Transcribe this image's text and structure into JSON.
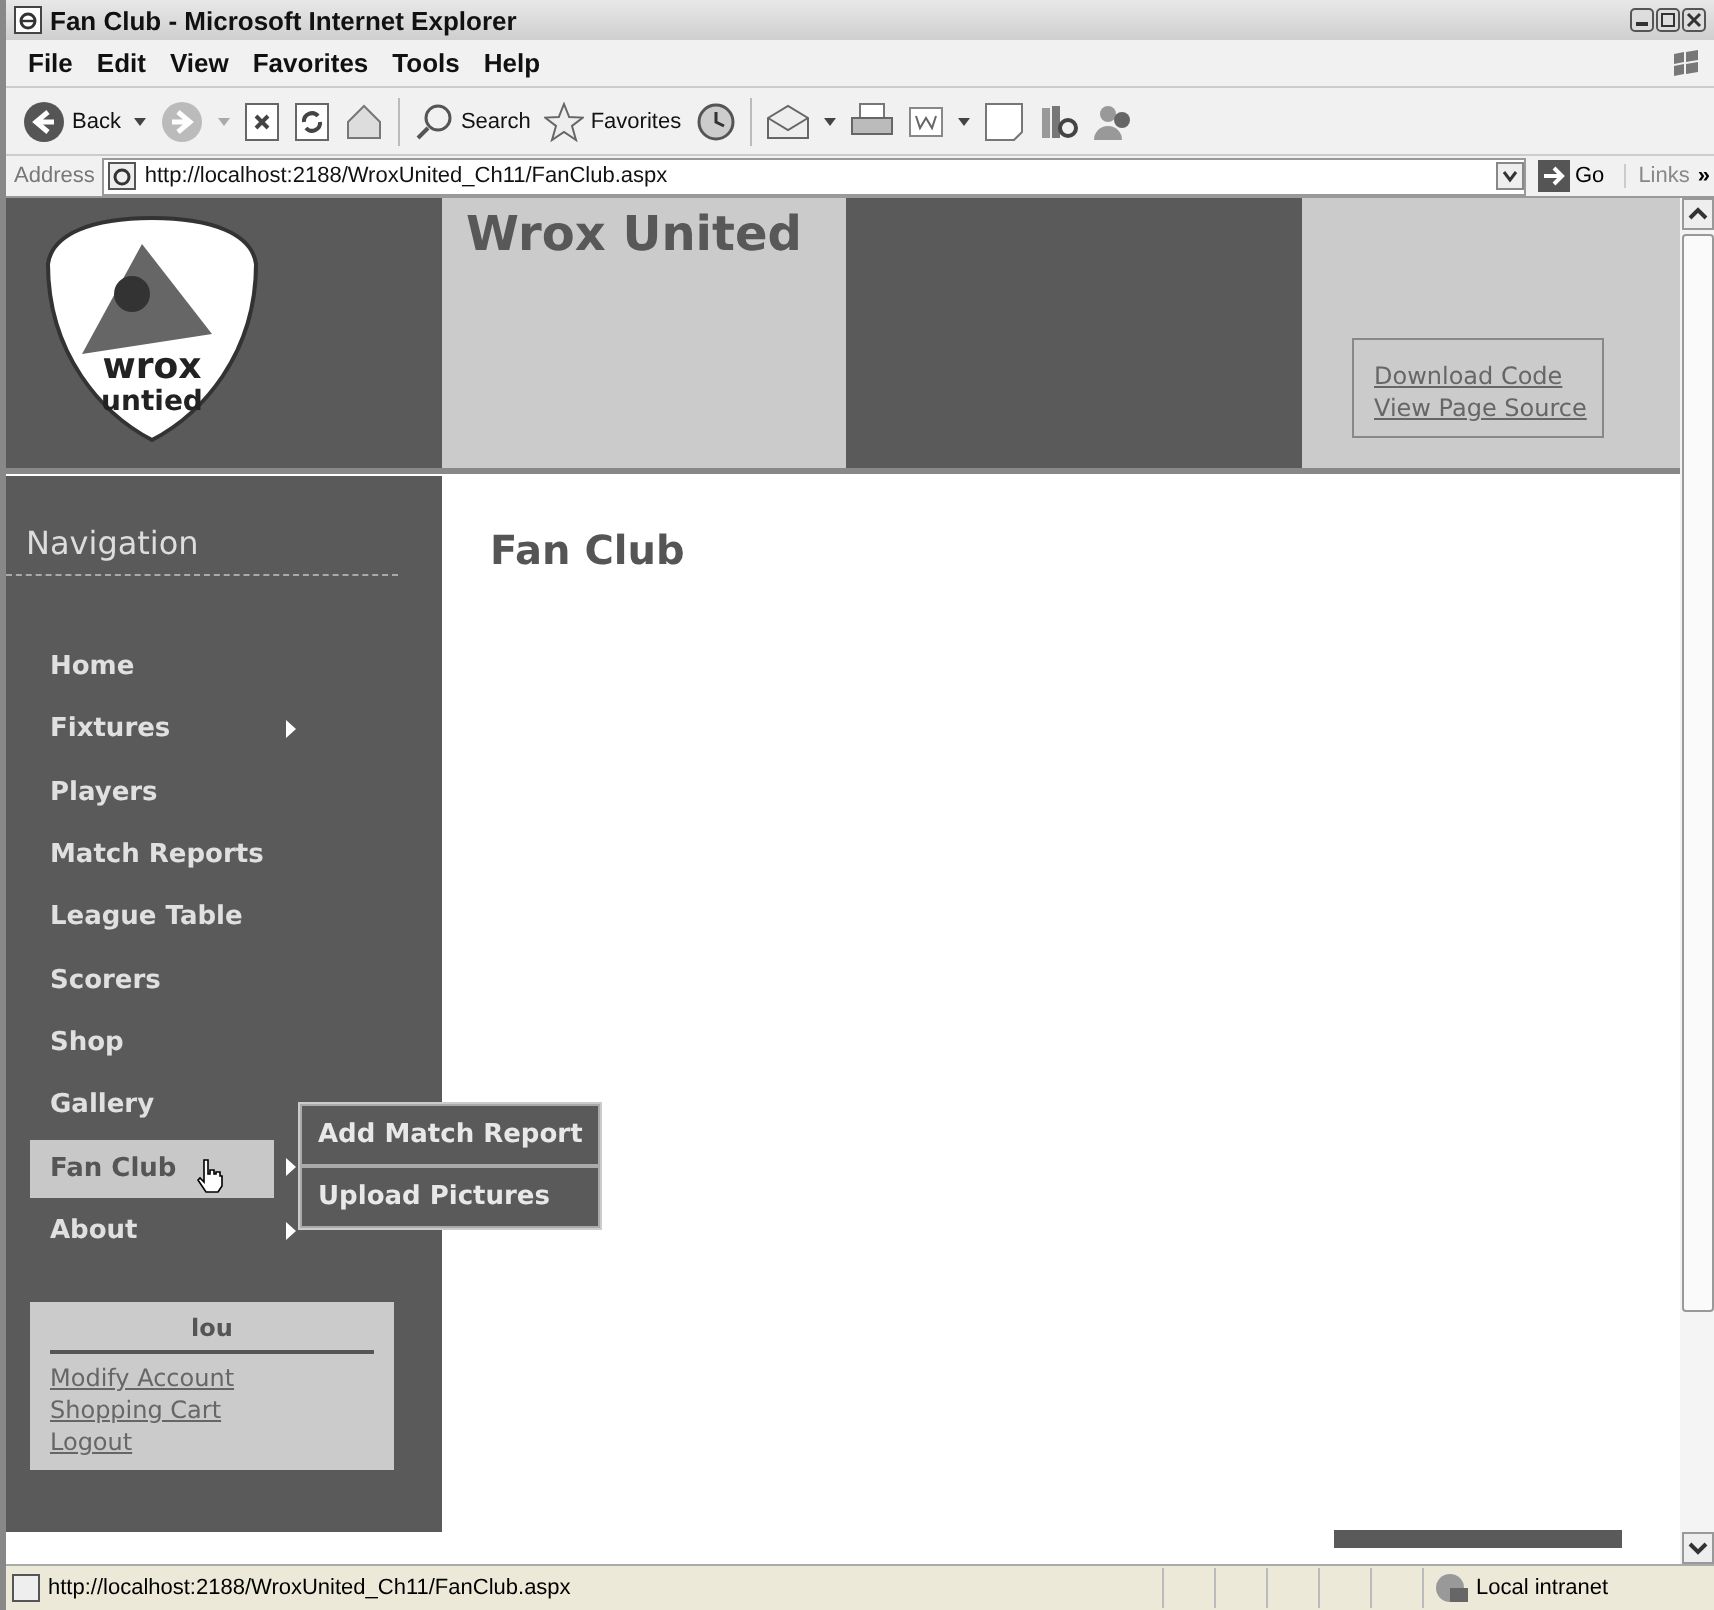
{
  "window": {
    "title": "Fan Club - Microsoft Internet Explorer"
  },
  "menu_bar": [
    "File",
    "Edit",
    "View",
    "Favorites",
    "Tools",
    "Help"
  ],
  "toolbar": {
    "back": "Back",
    "search": "Search",
    "favorites": "Favorites"
  },
  "address_bar": {
    "label": "Address",
    "url": "http://localhost:2188/WroxUnited_Ch11/FanClub.aspx",
    "go": "Go",
    "links": "Links",
    "more": "»"
  },
  "site": {
    "title": "Wrox United",
    "logo_text": [
      "wrox",
      "untied"
    ],
    "header_links": [
      "Download Code",
      "View Page Source"
    ]
  },
  "navigation": {
    "heading": "Navigation",
    "items": [
      {
        "label": "Home",
        "submenu": false,
        "selected": false
      },
      {
        "label": "Fixtures",
        "submenu": true,
        "selected": false
      },
      {
        "label": "Players",
        "submenu": false,
        "selected": false
      },
      {
        "label": "Match Reports",
        "submenu": false,
        "selected": false
      },
      {
        "label": "League Table",
        "submenu": false,
        "selected": false
      },
      {
        "label": "Scorers",
        "submenu": false,
        "selected": false
      },
      {
        "label": "Shop",
        "submenu": false,
        "selected": false
      },
      {
        "label": "Gallery",
        "submenu": false,
        "selected": false
      },
      {
        "label": "Fan Club",
        "submenu": true,
        "selected": true,
        "children": [
          "Add Match Report",
          "Upload Pictures"
        ]
      },
      {
        "label": "About",
        "submenu": true,
        "selected": false
      }
    ]
  },
  "user_box": {
    "name": "lou",
    "links": [
      "Modify Account",
      "Shopping Cart",
      "Logout"
    ]
  },
  "page": {
    "heading": "Fan Club"
  },
  "status_bar": {
    "url": "http://localhost:2188/WroxUnited_Ch11/FanClub.aspx",
    "zone": "Local intranet"
  }
}
